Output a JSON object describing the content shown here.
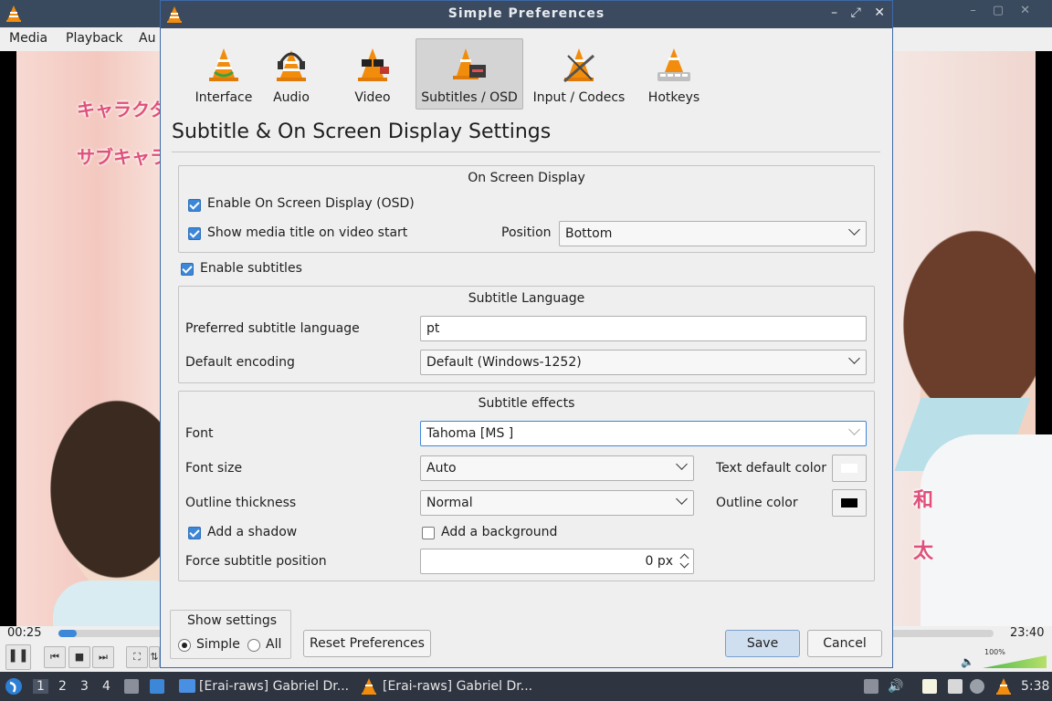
{
  "vlc": {
    "menu": [
      "Media",
      "Playback",
      "Au"
    ],
    "time_elapsed": "00:25",
    "time_total": "23:40",
    "progress_fraction": 0.02,
    "volume_label": "100%",
    "overlay_texts": [
      "キャラクタ",
      "サブキャラ",
      "和",
      "太"
    ]
  },
  "dialog": {
    "title": "Simple Preferences",
    "window_buttons": [
      "–",
      "⤢",
      "✕"
    ],
    "categories": [
      {
        "label": "Interface",
        "icon": "interface-cone-icon",
        "selected": false
      },
      {
        "label": "Audio",
        "icon": "audio-cone-headphones-icon",
        "selected": false
      },
      {
        "label": "Video",
        "icon": "video-cone-glasses-icon",
        "selected": false
      },
      {
        "label": "Subtitles / OSD",
        "icon": "subtitles-cone-icon",
        "selected": true
      },
      {
        "label": "Input / Codecs",
        "icon": "codecs-cone-icon",
        "selected": false
      },
      {
        "label": "Hotkeys",
        "icon": "hotkeys-cone-icon",
        "selected": false
      }
    ],
    "section_title": "Subtitle & On Screen Display Settings",
    "osd": {
      "title": "On Screen Display",
      "enable_osd_label": "Enable On Screen Display (OSD)",
      "enable_osd": true,
      "show_title_label": "Show media title on video start",
      "show_title": true,
      "position_label": "Position",
      "position_value": "Bottom"
    },
    "enable_subtitles_label": "Enable subtitles",
    "enable_subtitles": true,
    "language": {
      "title": "Subtitle Language",
      "preferred_label": "Preferred subtitle language",
      "preferred_value": "pt",
      "encoding_label": "Default encoding",
      "encoding_value": "Default (Windows-1252)"
    },
    "effects": {
      "title": "Subtitle effects",
      "font_label": "Font",
      "font_value": "Tahoma [MS  ]",
      "font_size_label": "Font size",
      "font_size_value": "Auto",
      "text_color_label": "Text default color",
      "text_color": "#ffffff",
      "outline_label": "Outline thickness",
      "outline_value": "Normal",
      "outline_color_label": "Outline color",
      "outline_color": "#000000",
      "shadow_label": "Add a shadow",
      "shadow": true,
      "background_label": "Add a background",
      "background": false,
      "force_pos_label": "Force subtitle position",
      "force_pos_value": "0 px"
    },
    "show_settings": {
      "title": "Show settings",
      "simple_label": "Simple",
      "all_label": "All",
      "selected": "Simple"
    },
    "buttons": {
      "reset": "Reset Preferences",
      "save": "Save",
      "cancel": "Cancel"
    }
  },
  "taskbar": {
    "workspaces": [
      "1",
      "2",
      "3",
      "4"
    ],
    "active_workspace": "1",
    "tasks": [
      {
        "label": "[Erai-raws] Gabriel Dr...",
        "icon": "folder-icon"
      },
      {
        "label": "[Erai-raws] Gabriel Dr...",
        "icon": "vlc-cone-icon"
      }
    ],
    "clock": "5:38"
  },
  "colors": {
    "accent": "#3d87d8",
    "titlebar": "#3b4a5f",
    "dialog_bg": "#efefef",
    "taskbar": "#2e3440"
  }
}
